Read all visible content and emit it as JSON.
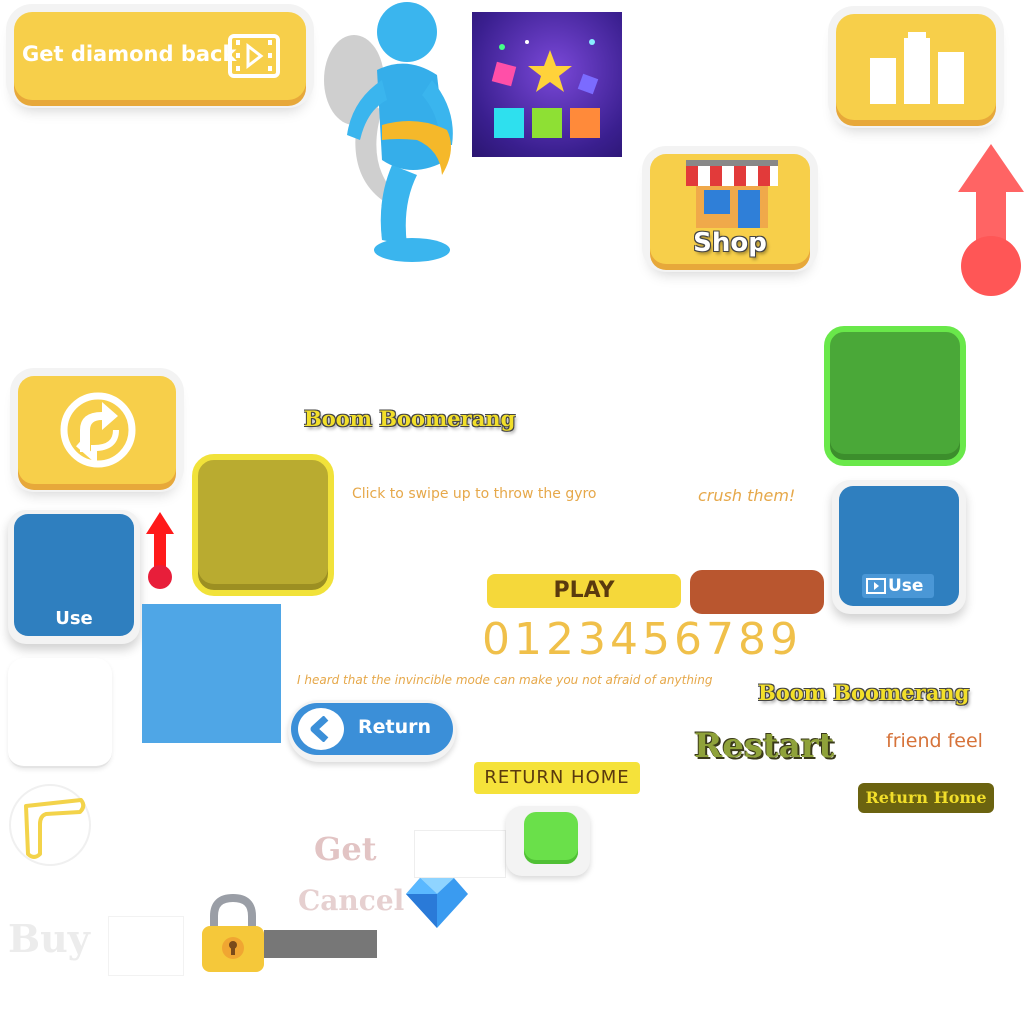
{
  "buttons": {
    "get_diamond_back": "Get diamond back",
    "shop": "Shop",
    "use_left": "Use",
    "use_right": "Use",
    "play": "PLAY",
    "return": "Return",
    "return_home_yellow": "RETURN HOME",
    "return_home_olive": "Return Home",
    "restart": "Restart",
    "get": "Get",
    "cancel": "Cancel",
    "buy": "Buy"
  },
  "texts": {
    "title_top": "Boom Boomerang",
    "title_right": "Boom Boomerang",
    "hint_swipe": "Click to swipe up to throw the gyro",
    "crush": "crush them!",
    "invincible": "I heard that the invincible mode can make you not afraid of anything",
    "friend_feel": "friend feel",
    "digits": "0123456789"
  },
  "colors": {
    "yellow": "#f7cf4a",
    "blue_square": "#2f7fbf",
    "green_square": "#4aa838",
    "olive_square": "#b9ab30",
    "rust": "#b9562f",
    "light_blue": "#4fa6e6",
    "red_arrow": "#ff5f5f"
  },
  "icons": [
    "film-icon",
    "bar-chart-icon",
    "shop-icon",
    "refresh-icon",
    "arrow-icon",
    "boomerang-icon",
    "diamond-icon",
    "lock-icon",
    "chevron-left-icon",
    "runner-figure",
    "game-logo"
  ]
}
